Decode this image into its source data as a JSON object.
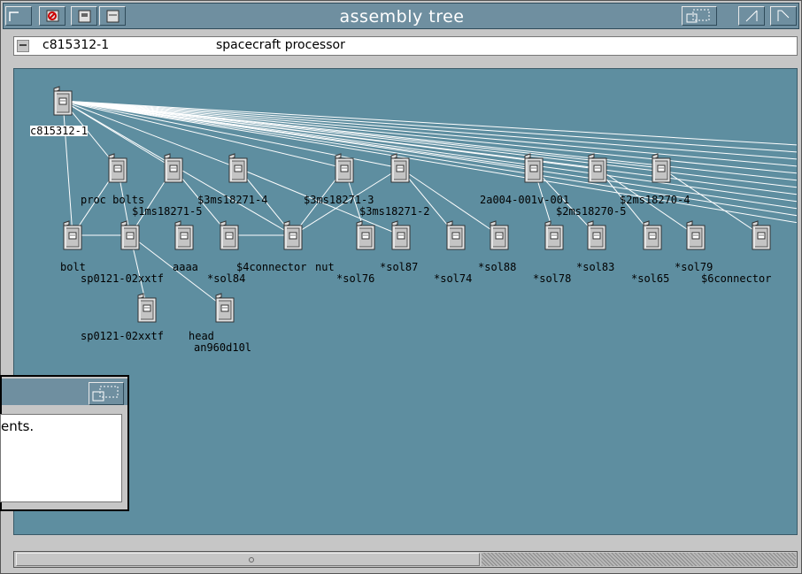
{
  "window": {
    "title": "assembly tree"
  },
  "path": {
    "code": "c815312-1",
    "description": "spacecraft processor"
  },
  "tree": {
    "nodes": [
      {
        "id": "root",
        "label": "c815312-1",
        "selected": true
      },
      {
        "id": "n1",
        "label": "proc bolts"
      },
      {
        "id": "n2",
        "label": "$1ms18271-5"
      },
      {
        "id": "n3",
        "label": "$3ms18271-4"
      },
      {
        "id": "n4",
        "label": "$3ms18271-3"
      },
      {
        "id": "n5",
        "label": "$3ms18271-2"
      },
      {
        "id": "n6",
        "label": "2a004-001v-001"
      },
      {
        "id": "n7",
        "label": "$2ms18270-4"
      },
      {
        "id": "n8",
        "label": "$2ms18270-5"
      },
      {
        "id": "c1",
        "label": "bolt"
      },
      {
        "id": "c2",
        "label": "sp0121-02xxtf"
      },
      {
        "id": "c3",
        "label": "aaaa"
      },
      {
        "id": "c4",
        "label": "*sol84"
      },
      {
        "id": "c5",
        "label": "$4connector"
      },
      {
        "id": "c6",
        "label": "nut"
      },
      {
        "id": "c7",
        "label": "*sol76"
      },
      {
        "id": "c8",
        "label": "*sol87"
      },
      {
        "id": "c9",
        "label": "*sol74"
      },
      {
        "id": "c10",
        "label": "*sol88"
      },
      {
        "id": "c11",
        "label": "*sol78"
      },
      {
        "id": "c12",
        "label": "*sol83"
      },
      {
        "id": "c13",
        "label": "*sol65"
      },
      {
        "id": "c14",
        "label": "*sol79"
      },
      {
        "id": "c15",
        "label": "$6connector"
      },
      {
        "id": "g1",
        "label": "sp0121-02xxtf"
      },
      {
        "id": "g2",
        "label": "head"
      },
      {
        "id": "g3",
        "label": "an960d10l"
      }
    ]
  },
  "dialog": {
    "message": "ents."
  },
  "colors": {
    "canvas": "#5e8ea0",
    "titlebar": "#6f8fa0",
    "edges": "#ffffff"
  }
}
